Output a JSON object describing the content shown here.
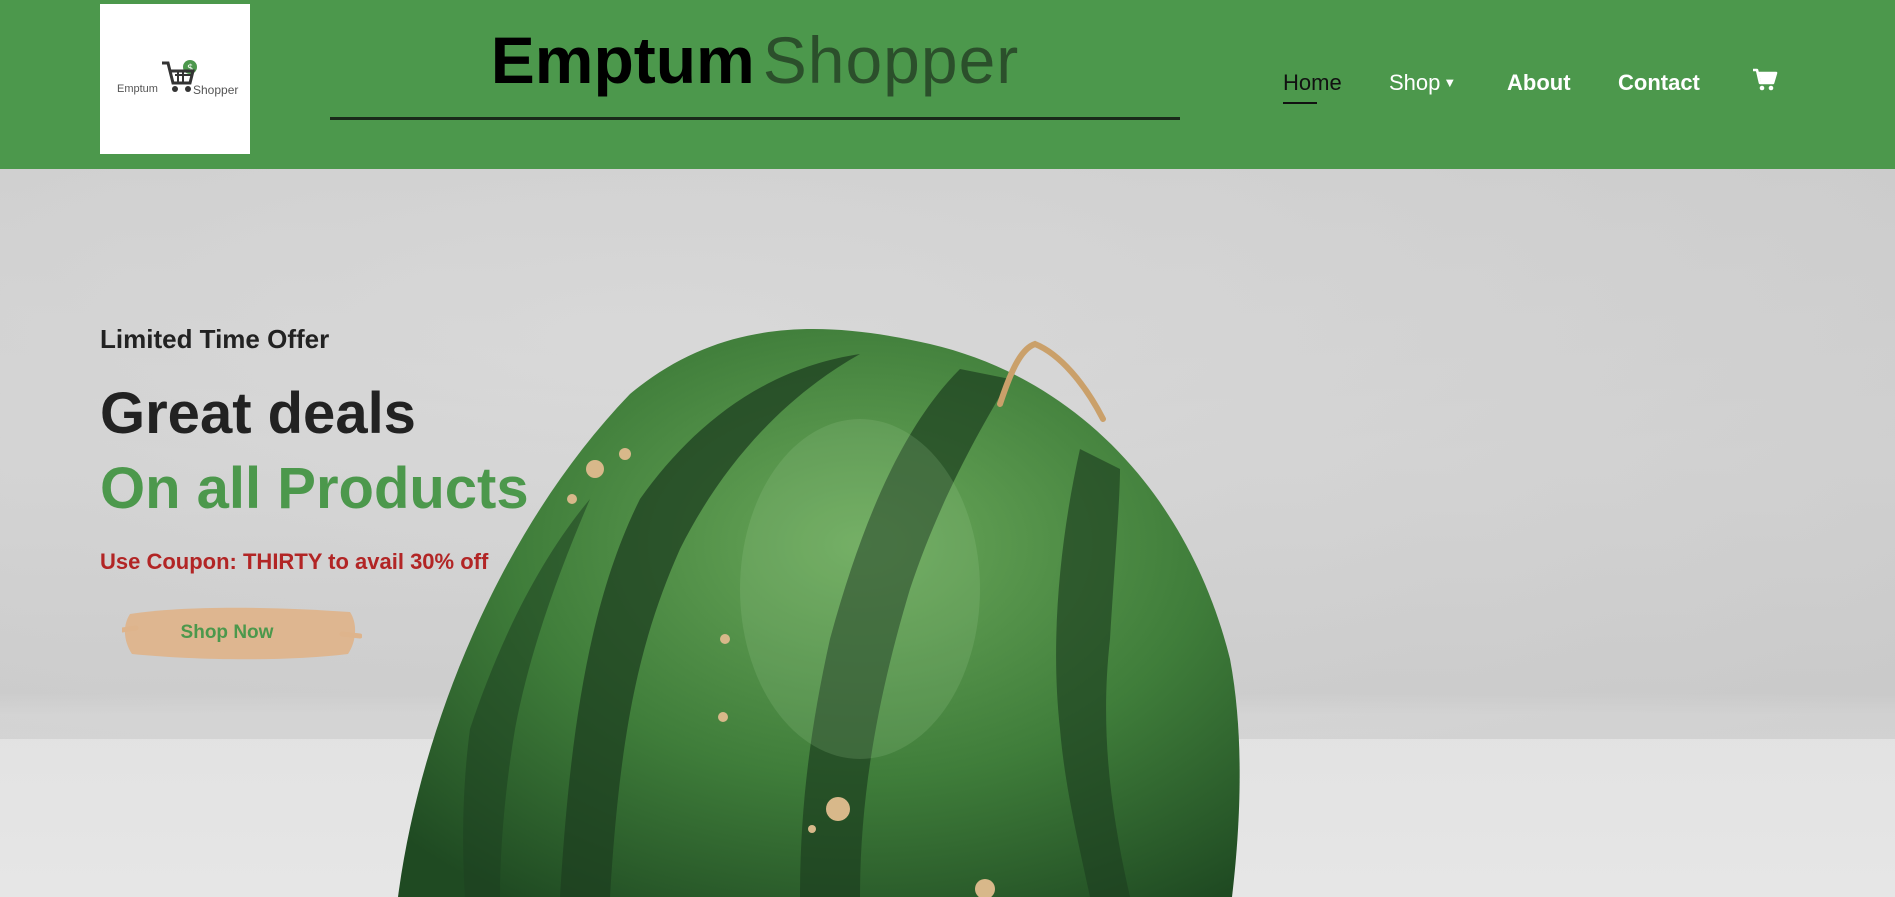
{
  "header": {
    "logo": {
      "word_left": "Emptum",
      "word_right": "Shopper"
    },
    "brand": {
      "part1": "Emptum",
      "part2": "Shopper"
    },
    "nav": [
      {
        "label": "Home",
        "active": true
      },
      {
        "label": "Shop",
        "has_dropdown": true,
        "icon": "caret-down-icon"
      },
      {
        "label": "About"
      },
      {
        "label": "Contact"
      }
    ],
    "cart_icon": "shopping-cart-icon",
    "colors": {
      "bar": "#4c984c",
      "active_link": "#111111",
      "link": "#ffffff"
    }
  },
  "hero": {
    "eyebrow": "Limited Time Offer",
    "title_line1": "Great deals",
    "title_line2": "On all Products",
    "coupon": "Use Coupon: THIRTY to avail 30% off",
    "cta": "Shop Now",
    "image": "watermelon",
    "colors": {
      "accent": "#4c984c",
      "coupon": "#b22525",
      "cta_bg": "#deb48c"
    }
  }
}
